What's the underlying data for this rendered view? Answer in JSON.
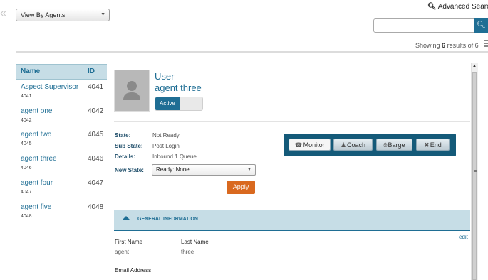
{
  "nav": {
    "collapse_glyph": "«"
  },
  "view_select": {
    "value": "View By Agents"
  },
  "advanced_search": {
    "label": "Advanced Search"
  },
  "search": {
    "placeholder": "",
    "value": ""
  },
  "results": {
    "prefix": "Showing",
    "shown": "6",
    "middle": "results of",
    "total": "6"
  },
  "agents_table": {
    "headers": {
      "name": "Name",
      "id": "ID"
    },
    "rows": [
      {
        "name": "Aspect Supervisor",
        "sub": "4041",
        "id": "4041"
      },
      {
        "name": "agent one",
        "sub": "4042",
        "id": "4042"
      },
      {
        "name": "agent two",
        "sub": "4045",
        "id": "4045"
      },
      {
        "name": "agent three",
        "sub": "4046",
        "id": "4046"
      },
      {
        "name": "agent four",
        "sub": "4047",
        "id": "4047"
      },
      {
        "name": "agent five",
        "sub": "4048",
        "id": "4048"
      }
    ]
  },
  "detail": {
    "title_line1": "User",
    "title_line2": "agent three",
    "status_toggle_label": "Active",
    "state_label": "State:",
    "state_value": "Not Ready",
    "substate_label": "Sub State:",
    "substate_value": "Post Login",
    "details_label": "Details:",
    "details_value": "Inbound 1 Queue",
    "new_state_label": "New State:",
    "new_state_value": "Ready: None",
    "apply_label": "Apply"
  },
  "actions": {
    "monitor": "Monitor",
    "coach": "Coach",
    "barge": "Barge",
    "end": "End"
  },
  "general": {
    "section_title": "GENERAL INFORMATION",
    "edit_label": "edit",
    "first_name_label": "First Name",
    "first_name_value": "agent",
    "last_name_label": "Last Name",
    "last_name_value": "three",
    "email_label": "Email Address"
  },
  "colors": {
    "accent": "#1f6e94",
    "header_bg": "#c6dde6",
    "apply": "#d9691f",
    "action_bar": "#145a79"
  },
  "icons": [
    "search-icon",
    "list-view-icon",
    "user-avatar-icon",
    "headset-icon",
    "coach-icon",
    "barge-icon",
    "end-call-icon",
    "collapse-up-icon",
    "chevron-down-icon"
  ]
}
